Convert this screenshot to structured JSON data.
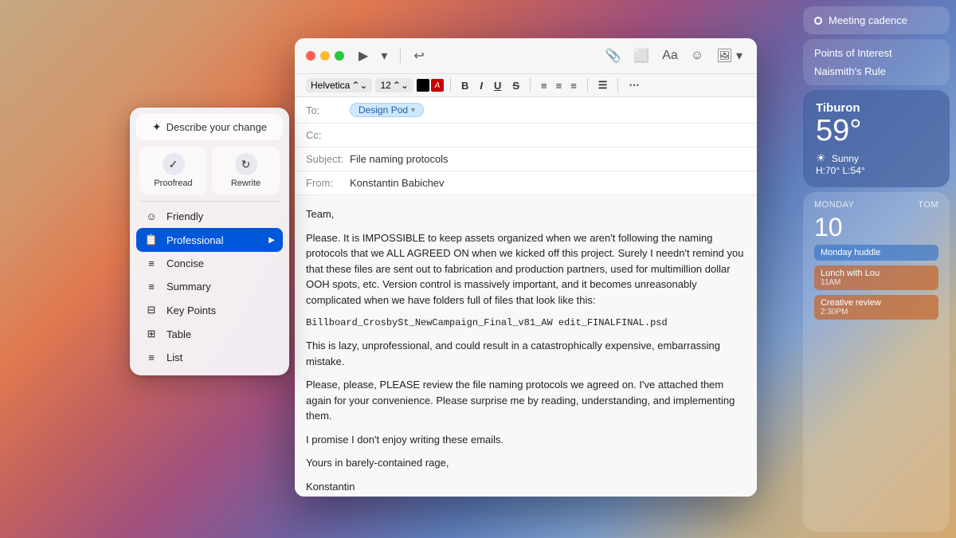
{
  "background": {
    "gradient": "macOS desktop gradient"
  },
  "meeting_badge": {
    "label": "Meeting cadence"
  },
  "widgets": {
    "links": [
      "Points of Interest",
      "Naismith's Rule"
    ],
    "weather": {
      "city": "Tiburon",
      "temp": "59°",
      "condition": "Sunny",
      "high_low": "H:70° L:54°"
    },
    "calendar": {
      "day_name": "MONDAY",
      "day_next": "TOM",
      "day_num": "10",
      "events": [
        {
          "title": "Monday huddle",
          "time": "",
          "color": "blue"
        },
        {
          "title": "Lunch with Lou",
          "time": "11AM",
          "color": "orange"
        },
        {
          "title": "Creative review",
          "time": "2:30PM",
          "color": "orange"
        }
      ]
    }
  },
  "mail": {
    "toolbar": {
      "send_icon": "▷",
      "attach_icon": "📎",
      "photo_icon": "🖼",
      "font_icon": "Aa",
      "emoji_icon": "☺",
      "undo_icon": "↩"
    },
    "format_bar": {
      "font": "Helvetica",
      "size": "12",
      "bold": "B",
      "italic": "I",
      "underline": "U",
      "strikethrough": "S"
    },
    "to": "Design Pod",
    "cc": "",
    "subject": "File naming protocols",
    "from": "Konstantin Babichev",
    "body_lines": [
      "Team,",
      "Please. It is IMPOSSIBLE to keep assets organized when we aren't following the naming protocols that we ALL AGREED ON when we kicked off this project. Surely I needn't remind you that these files are sent out to fabrication and production partners, used for multimillion dollar OOH spots, etc. Version control is massively important, and it becomes unreasonably complicated when we have folders full of files that look like this:",
      "Billboard_CrosbySt_NewCampaign_Final_v81_AW edit_FINALFINAL.psd",
      "This is lazy, unprofessional, and could result in a catastrophically expensive, embarrassing mistake.",
      "Please, please, PLEASE review the file naming protocols we agreed on. I've attached them again for your convenience. Please surprise me by reading, understanding, and implementing them.",
      "I promise I don't enjoy writing these emails.",
      "Yours in barely-contained rage,",
      "Konstantin"
    ]
  },
  "writing_tools": {
    "describe_label": "Describe your change",
    "wand_icon": "✦",
    "proofread_label": "Proofread",
    "rewrite_label": "Rewrite",
    "menu_items": [
      {
        "id": "friendly",
        "icon": "☺",
        "label": "Friendly"
      },
      {
        "id": "professional",
        "icon": "📋",
        "label": "Professional",
        "active": true
      },
      {
        "id": "concise",
        "icon": "≡",
        "label": "Concise"
      },
      {
        "id": "summary",
        "icon": "≡",
        "label": "Summary"
      },
      {
        "id": "key-points",
        "icon": "⊟",
        "label": "Key Points"
      },
      {
        "id": "table",
        "icon": "⊞",
        "label": "Table"
      },
      {
        "id": "list",
        "icon": "≡",
        "label": "List"
      }
    ]
  }
}
